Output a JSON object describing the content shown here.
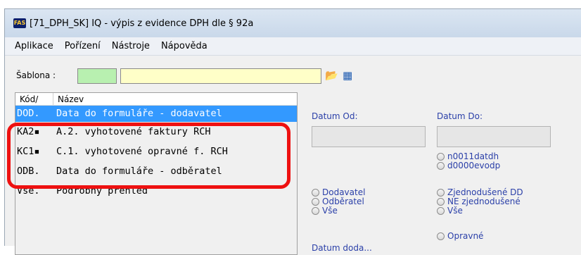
{
  "window": {
    "icon_text": "FAS",
    "title": "[71_DPH_SK] IQ - výpis z evidence DPH dle § 92a"
  },
  "menu": [
    "Aplikace",
    "Pořízení",
    "Nástroje",
    "Nápověda"
  ],
  "toolbar": {
    "sablona_label": "Šablona :",
    "sablona_code_value": "",
    "sablona_name_value": "",
    "open_icon": "folder-open-icon",
    "grid_icon": "grid-edit-icon"
  },
  "list": {
    "columns": [
      "Kód",
      "Název"
    ],
    "rows": [
      {
        "kod": "DOD.",
        "nazev": "Data do formuláře - dodavatel",
        "selected": true
      },
      {
        "kod": "KA2▪",
        "nazev": "A.2. vyhotovené faktury RCH",
        "selected": false
      },
      {
        "kod": "KC1▪",
        "nazev": "C.1. vyhotovené opravné f. RCH",
        "selected": false
      },
      {
        "kod": "ODB.",
        "nazev": "Data do formuláře - odběratel",
        "selected": false
      },
      {
        "kod": "Vše.",
        "nazev": "Podrobný přehled",
        "selected": false
      }
    ]
  },
  "filters": {
    "datum_od_label": "Datum Od:",
    "datum_do_label": "Datum Do:",
    "datum_od_value": "",
    "datum_do_value": "",
    "date_source_options": [
      "n0011datdh",
      "d0000evodp"
    ],
    "partner_options": [
      "Dodavatel",
      "Odběratel",
      "Vše"
    ],
    "simplified_options": [
      "Zjednodušené DD",
      "NE zjednodušené",
      "Vše"
    ],
    "correction_option": "Opravné",
    "partial_label": "Datum doda..."
  }
}
